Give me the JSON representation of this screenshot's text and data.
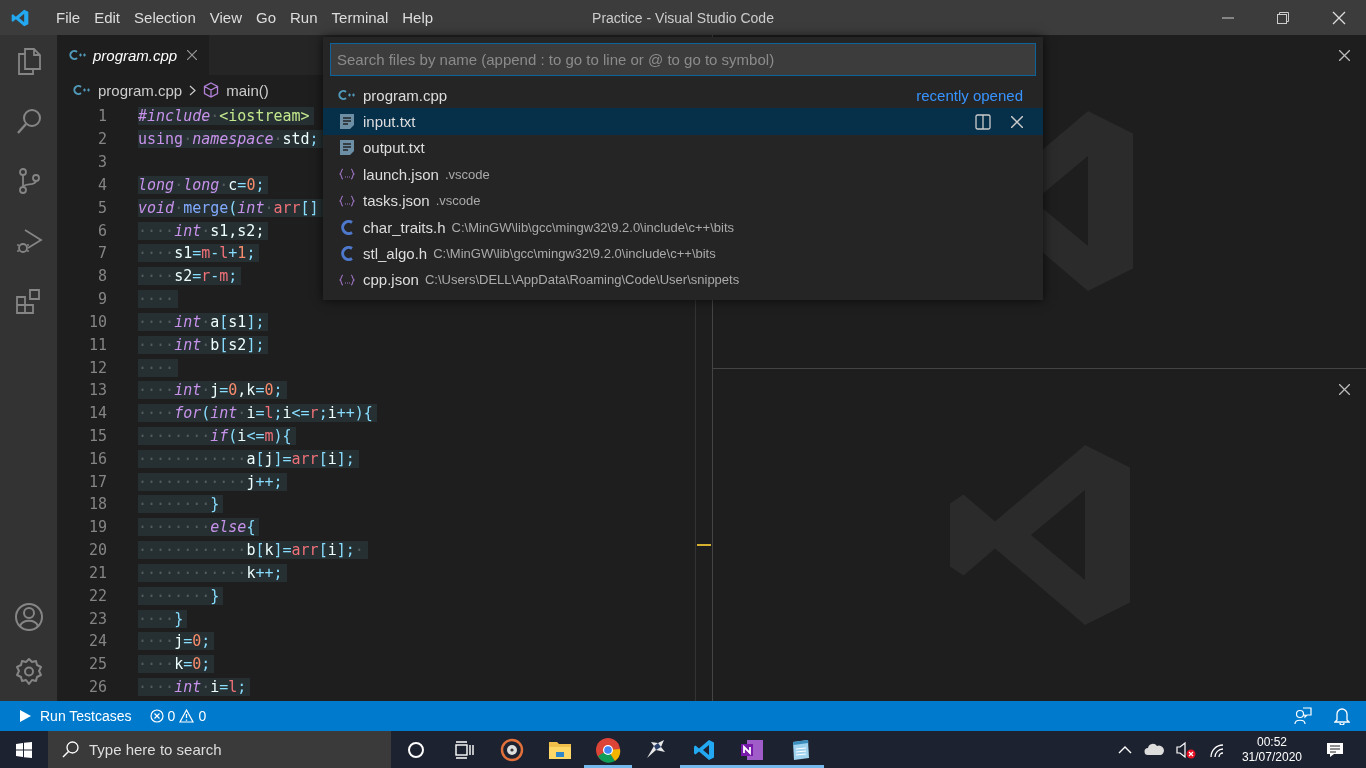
{
  "window": {
    "title": "Practice - Visual Studio Code"
  },
  "menu": [
    "File",
    "Edit",
    "Selection",
    "View",
    "Go",
    "Run",
    "Terminal",
    "Help"
  ],
  "tabs": [
    {
      "label": "program.cpp",
      "selected": true
    }
  ],
  "breadcrumbs": [
    "program.cpp",
    "main()"
  ],
  "code_lines": [
    {
      "number": "1",
      "tokens": [
        {
          "kind": "kw",
          "text": "#include"
        },
        {
          "kind": "ws",
          "text": "·"
        },
        {
          "kind": "str",
          "text": "<iostream>"
        }
      ]
    },
    {
      "number": "2",
      "tokens": [
        {
          "kind": "kw2",
          "text": "using"
        },
        {
          "kind": "ws",
          "text": "·"
        },
        {
          "kind": "kw",
          "text": "namespace"
        },
        {
          "kind": "ws",
          "text": "·"
        },
        {
          "kind": "plain",
          "text": "std"
        },
        {
          "kind": "op",
          "text": ";"
        }
      ]
    },
    {
      "number": "3"
    },
    {
      "number": "4",
      "tokens": [
        {
          "kind": "kw",
          "text": "long"
        },
        {
          "kind": "ws",
          "text": "·"
        },
        {
          "kind": "kw",
          "text": "long"
        },
        {
          "kind": "ws",
          "text": "·"
        },
        {
          "kind": "plain",
          "text": "c"
        },
        {
          "kind": "op",
          "text": "="
        },
        {
          "kind": "num",
          "text": "0"
        },
        {
          "kind": "op",
          "text": ";"
        }
      ]
    },
    {
      "number": "5",
      "tokens": [
        {
          "kind": "kw",
          "text": "void"
        },
        {
          "kind": "ws",
          "text": "·"
        },
        {
          "kind": "fn",
          "text": "merge"
        },
        {
          "kind": "op",
          "text": "("
        },
        {
          "kind": "kw",
          "text": "int"
        },
        {
          "kind": "ws",
          "text": "·"
        },
        {
          "kind": "param",
          "text": "arr"
        },
        {
          "kind": "op",
          "text": "[]"
        }
      ]
    },
    {
      "number": "6",
      "tokens": [
        {
          "kind": "ws",
          "text": "····"
        },
        {
          "kind": "kw",
          "text": "int"
        },
        {
          "kind": "ws",
          "text": "·"
        },
        {
          "kind": "plain",
          "text": "s1,s2;"
        }
      ]
    },
    {
      "number": "7",
      "tokens": [
        {
          "kind": "ws",
          "text": "····"
        },
        {
          "kind": "plain",
          "text": "s1"
        },
        {
          "kind": "op",
          "text": "="
        },
        {
          "kind": "param",
          "text": "m"
        },
        {
          "kind": "op",
          "text": "-"
        },
        {
          "kind": "param",
          "text": "l"
        },
        {
          "kind": "op",
          "text": "+"
        },
        {
          "kind": "num",
          "text": "1"
        },
        {
          "kind": "op",
          "text": ";"
        }
      ]
    },
    {
      "number": "8",
      "tokens": [
        {
          "kind": "ws",
          "text": "····"
        },
        {
          "kind": "plain",
          "text": "s2"
        },
        {
          "kind": "op",
          "text": "="
        },
        {
          "kind": "param",
          "text": "r"
        },
        {
          "kind": "op",
          "text": "-"
        },
        {
          "kind": "param",
          "text": "m"
        },
        {
          "kind": "op",
          "text": ";"
        }
      ]
    },
    {
      "number": "9",
      "tokens": [
        {
          "kind": "ws",
          "text": "····"
        }
      ]
    },
    {
      "number": "10",
      "tokens": [
        {
          "kind": "ws",
          "text": "····"
        },
        {
          "kind": "kw",
          "text": "int"
        },
        {
          "kind": "ws",
          "text": "·"
        },
        {
          "kind": "plain",
          "text": "a"
        },
        {
          "kind": "op",
          "text": "["
        },
        {
          "kind": "plain",
          "text": "s1"
        },
        {
          "kind": "op",
          "text": "];"
        }
      ]
    },
    {
      "number": "11",
      "tokens": [
        {
          "kind": "ws",
          "text": "····"
        },
        {
          "kind": "kw",
          "text": "int"
        },
        {
          "kind": "ws",
          "text": "·"
        },
        {
          "kind": "plain",
          "text": "b"
        },
        {
          "kind": "op",
          "text": "["
        },
        {
          "kind": "plain",
          "text": "s2"
        },
        {
          "kind": "op",
          "text": "];"
        }
      ]
    },
    {
      "number": "12",
      "tokens": [
        {
          "kind": "ws",
          "text": "····"
        }
      ]
    },
    {
      "number": "13",
      "tokens": [
        {
          "kind": "ws",
          "text": "····"
        },
        {
          "kind": "kw",
          "text": "int"
        },
        {
          "kind": "ws",
          "text": "·"
        },
        {
          "kind": "plain",
          "text": "j"
        },
        {
          "kind": "op",
          "text": "="
        },
        {
          "kind": "num",
          "text": "0"
        },
        {
          "kind": "plain",
          "text": ",k"
        },
        {
          "kind": "op",
          "text": "="
        },
        {
          "kind": "num",
          "text": "0"
        },
        {
          "kind": "op",
          "text": ";"
        }
      ]
    },
    {
      "number": "14",
      "tokens": [
        {
          "kind": "ws",
          "text": "····"
        },
        {
          "kind": "kw",
          "text": "for"
        },
        {
          "kind": "op",
          "text": "("
        },
        {
          "kind": "kw",
          "text": "int"
        },
        {
          "kind": "ws",
          "text": "·"
        },
        {
          "kind": "plain",
          "text": "i"
        },
        {
          "kind": "op",
          "text": "="
        },
        {
          "kind": "param",
          "text": "l"
        },
        {
          "kind": "op",
          "text": ";"
        },
        {
          "kind": "plain",
          "text": "i"
        },
        {
          "kind": "op",
          "text": "<="
        },
        {
          "kind": "param",
          "text": "r"
        },
        {
          "kind": "op",
          "text": ";"
        },
        {
          "kind": "plain",
          "text": "i"
        },
        {
          "kind": "op",
          "text": "++){"
        }
      ]
    },
    {
      "number": "15",
      "tokens": [
        {
          "kind": "ws",
          "text": "········"
        },
        {
          "kind": "kw",
          "text": "if"
        },
        {
          "kind": "op",
          "text": "("
        },
        {
          "kind": "plain",
          "text": "i"
        },
        {
          "kind": "op",
          "text": "<="
        },
        {
          "kind": "param",
          "text": "m"
        },
        {
          "kind": "op",
          "text": "){"
        }
      ]
    },
    {
      "number": "16",
      "tokens": [
        {
          "kind": "ws",
          "text": "············"
        },
        {
          "kind": "plain",
          "text": "a"
        },
        {
          "kind": "op",
          "text": "["
        },
        {
          "kind": "plain",
          "text": "j"
        },
        {
          "kind": "op",
          "text": "]="
        },
        {
          "kind": "param",
          "text": "arr"
        },
        {
          "kind": "op",
          "text": "["
        },
        {
          "kind": "plain",
          "text": "i"
        },
        {
          "kind": "op",
          "text": "];"
        }
      ]
    },
    {
      "number": "17",
      "tokens": [
        {
          "kind": "ws",
          "text": "············"
        },
        {
          "kind": "plain",
          "text": "j"
        },
        {
          "kind": "op",
          "text": "++;"
        }
      ]
    },
    {
      "number": "18",
      "tokens": [
        {
          "kind": "ws",
          "text": "········"
        },
        {
          "kind": "op",
          "text": "}"
        }
      ]
    },
    {
      "number": "19",
      "tokens": [
        {
          "kind": "ws",
          "text": "········"
        },
        {
          "kind": "kw",
          "text": "else"
        },
        {
          "kind": "op",
          "text": "{"
        }
      ]
    },
    {
      "number": "20",
      "tokens": [
        {
          "kind": "ws",
          "text": "············"
        },
        {
          "kind": "plain",
          "text": "b"
        },
        {
          "kind": "op",
          "text": "["
        },
        {
          "kind": "plain",
          "text": "k"
        },
        {
          "kind": "op",
          "text": "]="
        },
        {
          "kind": "param",
          "text": "arr"
        },
        {
          "kind": "op",
          "text": "["
        },
        {
          "kind": "plain",
          "text": "i"
        },
        {
          "kind": "op",
          "text": "];"
        },
        {
          "kind": "ws",
          "text": "·"
        }
      ]
    },
    {
      "number": "21",
      "tokens": [
        {
          "kind": "ws",
          "text": "············"
        },
        {
          "kind": "plain",
          "text": "k"
        },
        {
          "kind": "op",
          "text": "++;"
        }
      ]
    },
    {
      "number": "22",
      "tokens": [
        {
          "kind": "ws",
          "text": "········"
        },
        {
          "kind": "op",
          "text": "}"
        }
      ]
    },
    {
      "number": "23",
      "tokens": [
        {
          "kind": "ws",
          "text": "····"
        },
        {
          "kind": "op",
          "text": "}"
        }
      ]
    },
    {
      "number": "24",
      "tokens": [
        {
          "kind": "ws",
          "text": "····"
        },
        {
          "kind": "plain",
          "text": "j"
        },
        {
          "kind": "op",
          "text": "="
        },
        {
          "kind": "num",
          "text": "0"
        },
        {
          "kind": "op",
          "text": ";"
        }
      ]
    },
    {
      "number": "25",
      "tokens": [
        {
          "kind": "ws",
          "text": "····"
        },
        {
          "kind": "plain",
          "text": "k"
        },
        {
          "kind": "op",
          "text": "="
        },
        {
          "kind": "num",
          "text": "0"
        },
        {
          "kind": "op",
          "text": ";"
        }
      ]
    },
    {
      "number": "26",
      "tokens": [
        {
          "kind": "ws",
          "text": "····"
        },
        {
          "kind": "kw",
          "text": "int"
        },
        {
          "kind": "ws",
          "text": "·"
        },
        {
          "kind": "plain",
          "text": "i"
        },
        {
          "kind": "op",
          "text": "="
        },
        {
          "kind": "param",
          "text": "l"
        },
        {
          "kind": "op",
          "text": ";"
        }
      ]
    }
  ],
  "quick_open": {
    "placeholder": "Search files by name (append : to go to line or @ to go to symbol)",
    "items": [
      {
        "kind": "cpp",
        "name": "program.cpp",
        "badge": "recently opened",
        "selected": false
      },
      {
        "kind": "text",
        "name": "input.txt",
        "selected": true
      },
      {
        "kind": "text",
        "name": "output.txt",
        "selected": false
      },
      {
        "kind": "json",
        "name": "launch.json",
        "detail": ".vscode",
        "selected": false
      },
      {
        "kind": "json",
        "name": "tasks.json",
        "detail": ".vscode",
        "selected": false
      },
      {
        "kind": "c",
        "name": "char_traits.h",
        "detail": "C:\\MinGW\\lib\\gcc\\mingw32\\9.2.0\\include\\c++\\bits",
        "selected": false
      },
      {
        "kind": "c",
        "name": "stl_algo.h",
        "detail": "C:\\MinGW\\lib\\gcc\\mingw32\\9.2.0\\include\\c++\\bits",
        "selected": false
      },
      {
        "kind": "json",
        "name": "cpp.json",
        "detail": "C:\\Users\\DELL\\AppData\\Roaming\\Code\\User\\snippets",
        "selected": false
      }
    ]
  },
  "status_bar": {
    "run": "Run Testcases",
    "errors": "0",
    "warnings": "0"
  },
  "taskbar": {
    "search_placeholder": "Type here to search",
    "apps": [
      {
        "kind": "cortana",
        "running": false
      },
      {
        "kind": "taskview",
        "running": false
      },
      {
        "kind": "groove",
        "running": false
      },
      {
        "kind": "explorer",
        "running": false
      },
      {
        "kind": "chrome",
        "running": true
      },
      {
        "kind": "bird",
        "running": false
      },
      {
        "kind": "vscode",
        "running": true
      },
      {
        "kind": "onenote",
        "running": true
      },
      {
        "kind": "notepad",
        "running": true
      }
    ],
    "time": "00:52",
    "date": "31/07/2020"
  }
}
